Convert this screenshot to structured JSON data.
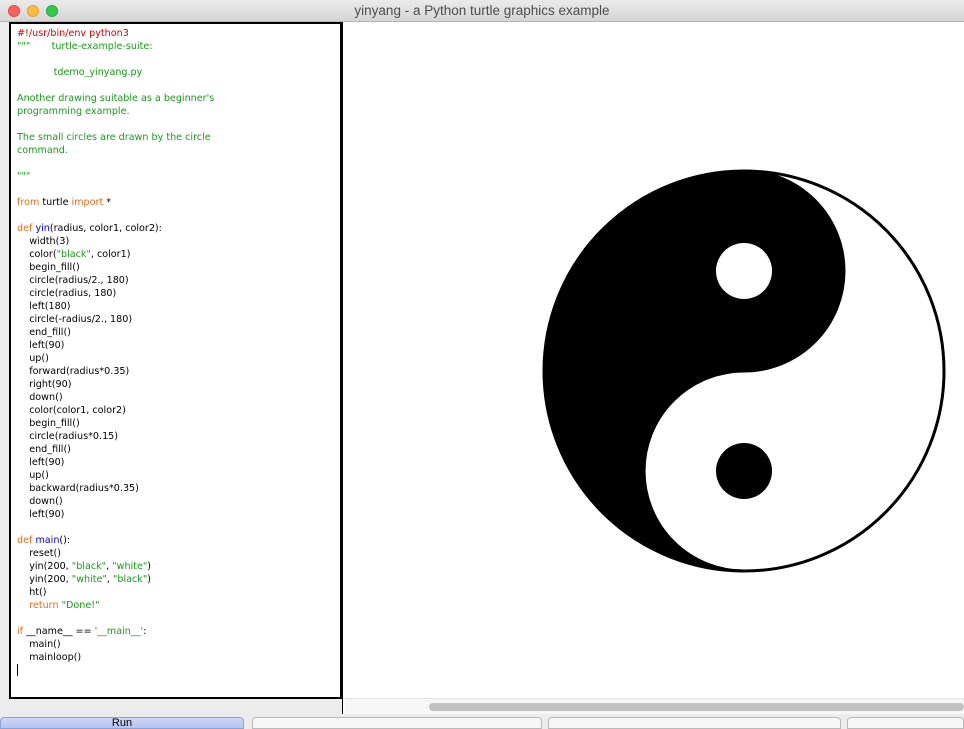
{
  "window": {
    "title": "yinyang - a Python turtle graphics example"
  },
  "editor": {
    "lines": [
      [
        [
          "#!/usr/bin/env python3",
          "red"
        ]
      ],
      [
        [
          "\"\"\"       turtle-example-suite:",
          "green"
        ]
      ],
      [
        [
          "",
          ""
        ]
      ],
      [
        [
          "            tdemo_yinyang.py",
          "green"
        ]
      ],
      [
        [
          "",
          ""
        ]
      ],
      [
        [
          "Another drawing suitable as a beginner's",
          "green"
        ]
      ],
      [
        [
          "programming example.",
          "green"
        ]
      ],
      [
        [
          "",
          ""
        ]
      ],
      [
        [
          "The small circles are drawn by the circle",
          "green"
        ]
      ],
      [
        [
          "command.",
          "green"
        ]
      ],
      [
        [
          "",
          ""
        ]
      ],
      [
        [
          "\"\"\"",
          "green"
        ]
      ],
      [
        [
          "",
          ""
        ]
      ],
      [
        [
          "from",
          "orange"
        ],
        [
          " turtle ",
          ""
        ],
        [
          "import",
          "orange"
        ],
        [
          " *",
          ""
        ]
      ],
      [
        [
          "",
          ""
        ]
      ],
      [
        [
          "def",
          "orange"
        ],
        [
          " ",
          ""
        ],
        [
          "yin",
          "blue"
        ],
        [
          "(radius, color1, color2):",
          ""
        ]
      ],
      [
        [
          "    width(3)",
          ""
        ]
      ],
      [
        [
          "    color(",
          ""
        ],
        [
          "\"black\"",
          "green"
        ],
        [
          ", color1)",
          ""
        ]
      ],
      [
        [
          "    begin_fill()",
          ""
        ]
      ],
      [
        [
          "    circle(radius/2., 180)",
          ""
        ]
      ],
      [
        [
          "    circle(radius, 180)",
          ""
        ]
      ],
      [
        [
          "    left(180)",
          ""
        ]
      ],
      [
        [
          "    circle(-radius/2., 180)",
          ""
        ]
      ],
      [
        [
          "    end_fill()",
          ""
        ]
      ],
      [
        [
          "    left(90)",
          ""
        ]
      ],
      [
        [
          "    up()",
          ""
        ]
      ],
      [
        [
          "    forward(radius*0.35)",
          ""
        ]
      ],
      [
        [
          "    right(90)",
          ""
        ]
      ],
      [
        [
          "    down()",
          ""
        ]
      ],
      [
        [
          "    color(color1, color2)",
          ""
        ]
      ],
      [
        [
          "    begin_fill()",
          ""
        ]
      ],
      [
        [
          "    circle(radius*0.15)",
          ""
        ]
      ],
      [
        [
          "    end_fill()",
          ""
        ]
      ],
      [
        [
          "    left(90)",
          ""
        ]
      ],
      [
        [
          "    up()",
          ""
        ]
      ],
      [
        [
          "    backward(radius*0.35)",
          ""
        ]
      ],
      [
        [
          "    down()",
          ""
        ]
      ],
      [
        [
          "    left(90)",
          ""
        ]
      ],
      [
        [
          "",
          ""
        ]
      ],
      [
        [
          "def",
          "orange"
        ],
        [
          " ",
          ""
        ],
        [
          "main",
          "blue"
        ],
        [
          "():",
          ""
        ]
      ],
      [
        [
          "    reset()",
          ""
        ]
      ],
      [
        [
          "    yin(200, ",
          ""
        ],
        [
          "\"black\"",
          "green"
        ],
        [
          ", ",
          ""
        ],
        [
          "\"white\"",
          "green"
        ],
        [
          ")",
          ""
        ]
      ],
      [
        [
          "    yin(200, ",
          ""
        ],
        [
          "\"white\"",
          "green"
        ],
        [
          ", ",
          ""
        ],
        [
          "\"black\"",
          "green"
        ],
        [
          ")",
          ""
        ]
      ],
      [
        [
          "    ht()",
          ""
        ]
      ],
      [
        [
          "    ",
          ""
        ],
        [
          "return",
          "orange"
        ],
        [
          " ",
          ""
        ],
        [
          "\"Done!\"",
          "green"
        ]
      ],
      [
        [
          "",
          ""
        ]
      ],
      [
        [
          "if",
          "orange"
        ],
        [
          " __name__ == ",
          ""
        ],
        [
          "'__main__'",
          "green"
        ],
        [
          ":",
          ""
        ]
      ],
      [
        [
          "    main()",
          ""
        ]
      ],
      [
        [
          "    mainloop()",
          ""
        ]
      ]
    ]
  },
  "colors": {
    "red": "#d40000",
    "green": "#1b9a1b",
    "orange": "#e0701a",
    "blue": "#0000ee"
  },
  "drawing": {
    "name": "yin-yang",
    "fill_dark": "#000000",
    "fill_light": "#ffffff"
  },
  "buttons": [
    {
      "label": "Run"
    },
    {
      "label": ""
    },
    {
      "label": ""
    },
    {
      "label": ""
    }
  ]
}
